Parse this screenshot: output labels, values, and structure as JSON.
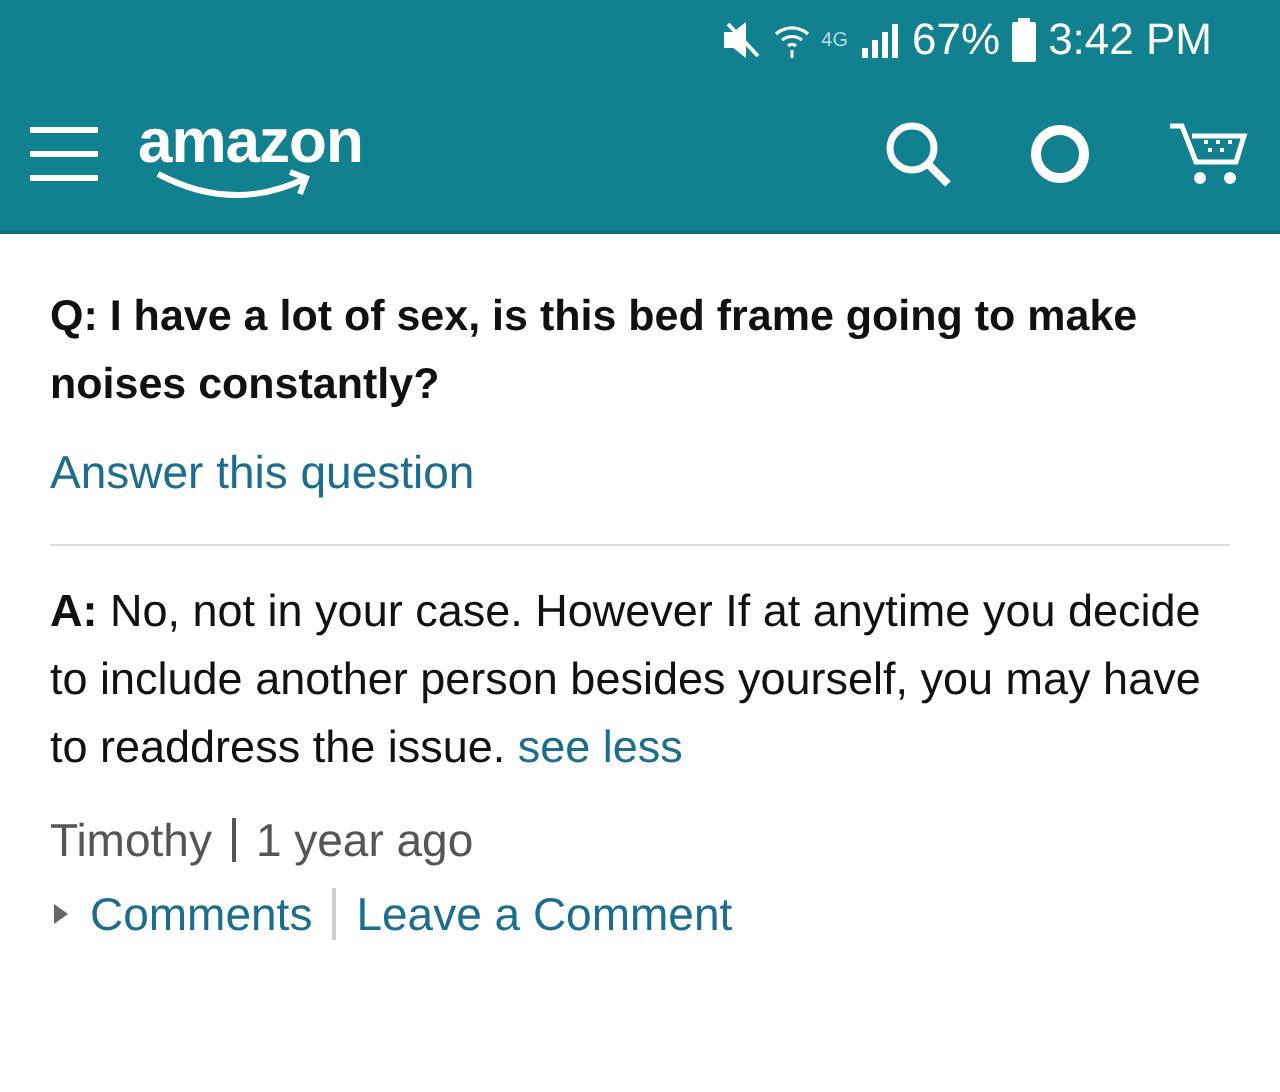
{
  "status_bar": {
    "network": "4G",
    "battery_percent": "67%",
    "time": "3:42 PM"
  },
  "header": {
    "logo": "amazon"
  },
  "question": {
    "prefix": "Q:",
    "text": "I have a lot of sex, is this bed frame going to make noises constantly?"
  },
  "answer_link": "Answer this question",
  "answer": {
    "prefix": "A:",
    "text": "No, not in your case. However If at anytime you decide to include another person besides yourself, you may have to readdress the issue.",
    "toggle": "see less"
  },
  "meta": {
    "author": "Timothy",
    "time": "1 year ago"
  },
  "actions": {
    "expanded": false,
    "comments": "Comments",
    "leave_comment": "Leave a Comment"
  }
}
